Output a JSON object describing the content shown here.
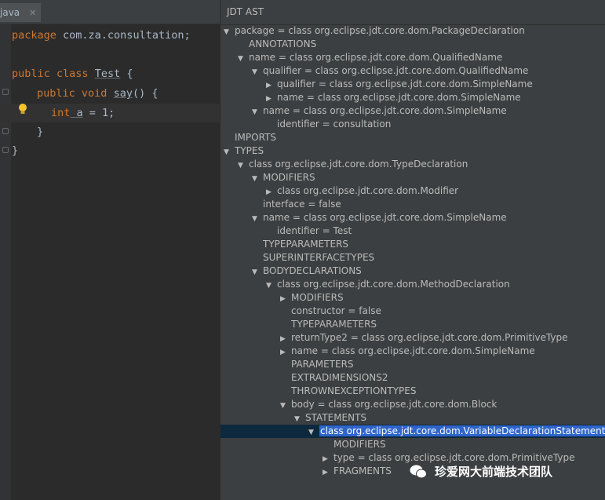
{
  "editor": {
    "tab_label": "java",
    "tab_close": "✕",
    "lines": [
      {
        "text": ""
      },
      {
        "text": ""
      }
    ],
    "code": {
      "package_kw": "package",
      "package_name": " com.za.consultation;",
      "public_kw": "public",
      "class_kw": " class ",
      "class_name": "Test",
      "class_brace": " {",
      "m_public": "public",
      "m_void": " void ",
      "m_name": "say",
      "m_rest": "() {",
      "v_type": "int",
      "v_name": " a",
      "v_rest": " = 1;",
      "close_inner": "}",
      "close_outer": "}"
    }
  },
  "ast": {
    "title": "JDT AST",
    "nodes": [
      {
        "arrow": "▼",
        "label": "package = class org.eclipse.jdt.core.dom.PackageDeclaration",
        "level": 0
      },
      {
        "arrow": "",
        "label": "ANNOTATIONS",
        "level": 1
      },
      {
        "arrow": "▼",
        "label": "name = class org.eclipse.jdt.core.dom.QualifiedName",
        "level": 1
      },
      {
        "arrow": "▼",
        "label": "qualifier = class org.eclipse.jdt.core.dom.QualifiedName",
        "level": 2
      },
      {
        "arrow": "▶",
        "label": "qualifier = class org.eclipse.jdt.core.dom.SimpleName",
        "level": 3
      },
      {
        "arrow": "▶",
        "label": "name = class org.eclipse.jdt.core.dom.SimpleName",
        "level": 3
      },
      {
        "arrow": "▼",
        "label": "name = class org.eclipse.jdt.core.dom.SimpleName",
        "level": 2
      },
      {
        "arrow": "",
        "label": "identifier = consultation",
        "level": 3
      },
      {
        "arrow": "",
        "label": "IMPORTS",
        "level": 0
      },
      {
        "arrow": "▼",
        "label": "TYPES",
        "level": 0
      },
      {
        "arrow": "▼",
        "label": "class org.eclipse.jdt.core.dom.TypeDeclaration",
        "level": 1
      },
      {
        "arrow": "▼",
        "label": "MODIFIERS",
        "level": 2
      },
      {
        "arrow": "▶",
        "label": "class org.eclipse.jdt.core.dom.Modifier",
        "level": 3
      },
      {
        "arrow": "",
        "label": "interface = false",
        "level": 2
      },
      {
        "arrow": "▼",
        "label": "name = class org.eclipse.jdt.core.dom.SimpleName",
        "level": 2
      },
      {
        "arrow": "",
        "label": "identifier = Test",
        "level": 3
      },
      {
        "arrow": "",
        "label": "TYPEPARAMETERS",
        "level": 2
      },
      {
        "arrow": "",
        "label": "SUPERINTERFACETYPES",
        "level": 2
      },
      {
        "arrow": "▼",
        "label": "BODYDECLARATIONS",
        "level": 2
      },
      {
        "arrow": "▼",
        "label": "class org.eclipse.jdt.core.dom.MethodDeclaration",
        "level": 3
      },
      {
        "arrow": "▶",
        "label": "MODIFIERS",
        "level": 4
      },
      {
        "arrow": "",
        "label": "constructor = false",
        "level": 4
      },
      {
        "arrow": "",
        "label": "TYPEPARAMETERS",
        "level": 4
      },
      {
        "arrow": "▶",
        "label": "returnType2 = class org.eclipse.jdt.core.dom.PrimitiveType",
        "level": 4
      },
      {
        "arrow": "▶",
        "label": "name = class org.eclipse.jdt.core.dom.SimpleName",
        "level": 4
      },
      {
        "arrow": "",
        "label": "PARAMETERS",
        "level": 4
      },
      {
        "arrow": "",
        "label": "EXTRADIMENSIONS2",
        "level": 4
      },
      {
        "arrow": "",
        "label": "THROWNEXCEPTIONTYPES",
        "level": 4
      },
      {
        "arrow": "▼",
        "label": "body = class org.eclipse.jdt.core.dom.Block",
        "level": 4
      },
      {
        "arrow": "▼",
        "label": "STATEMENTS",
        "level": 5
      },
      {
        "arrow": "▼",
        "label": "class org.eclipse.jdt.core.dom.VariableDeclarationStatement",
        "level": 6,
        "selected": true
      },
      {
        "arrow": "",
        "label": "MODIFIERS",
        "level": 7
      },
      {
        "arrow": "▶",
        "label": "type = class org.eclipse.jdt.core.dom.PrimitiveType",
        "level": 7
      },
      {
        "arrow": "▶",
        "label": "FRAGMENTS",
        "level": 7
      }
    ]
  },
  "watermark": {
    "text": "珍爱网大前端技术团队"
  }
}
